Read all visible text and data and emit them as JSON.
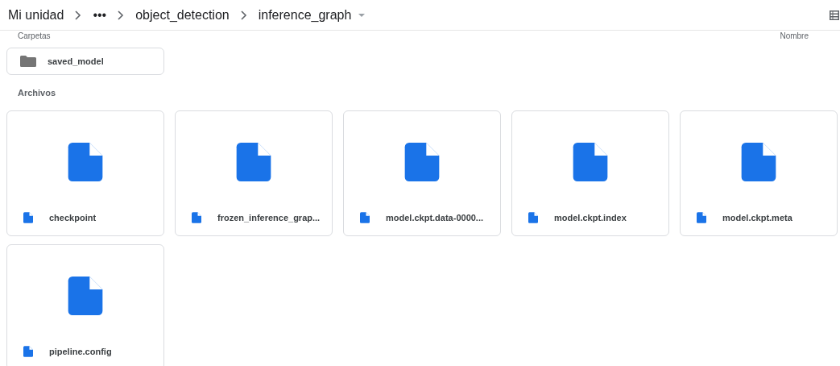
{
  "breadcrumb": [
    {
      "label": "Mi unidad",
      "kind": "text"
    },
    {
      "label": "•••",
      "kind": "text"
    },
    {
      "label": "object_detection",
      "kind": "text"
    },
    {
      "label": "inference_graph",
      "kind": "current"
    }
  ],
  "folders_heading": "Carpetas",
  "sort_label": "Nombre",
  "folders": [
    {
      "name": "saved_model"
    }
  ],
  "files_heading": "Archivos",
  "files": [
    {
      "name": "checkpoint"
    },
    {
      "name": "frozen_inference_grap..."
    },
    {
      "name": "model.ckpt.data-0000..."
    },
    {
      "name": "model.ckpt.index"
    },
    {
      "name": "model.ckpt.meta"
    },
    {
      "name": "pipeline.config"
    }
  ]
}
